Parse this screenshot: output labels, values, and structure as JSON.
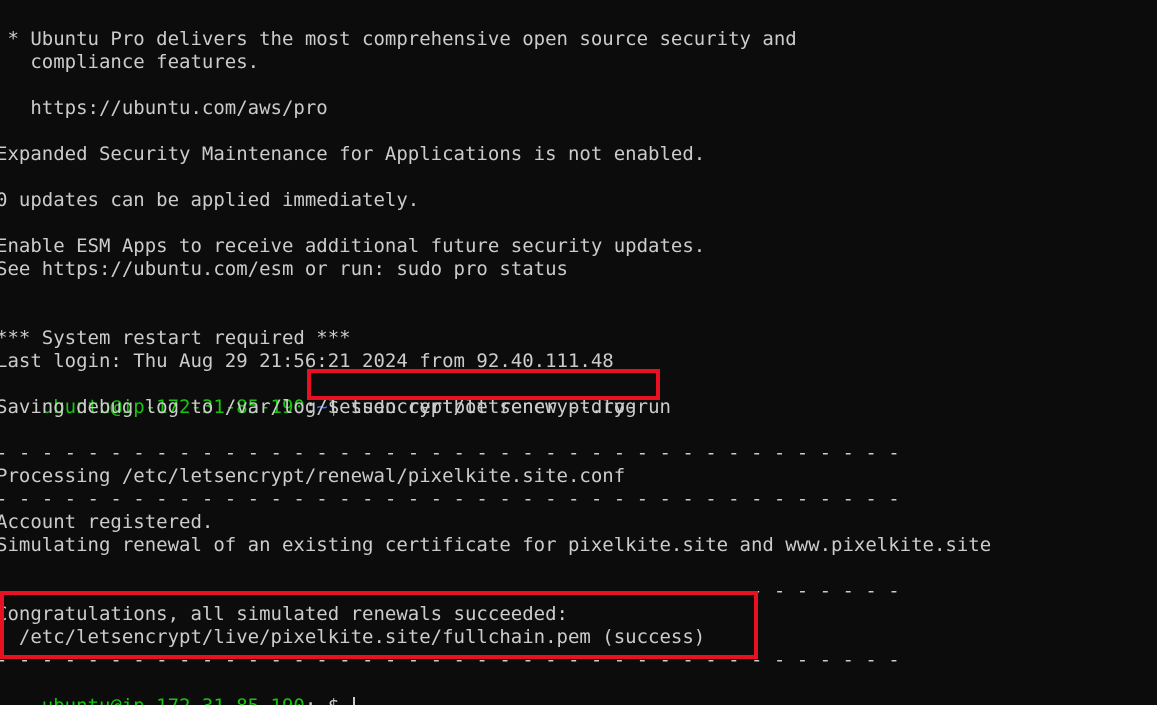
{
  "terminal": {
    "lines": [
      " * Ubuntu Pro delivers the most comprehensive open source security and",
      "   compliance features.",
      "",
      "   https://ubuntu.com/aws/pro",
      "",
      "Expanded Security Maintenance for Applications is not enabled.",
      "",
      "0 updates can be applied immediately.",
      "",
      "Enable ESM Apps to receive additional future security updates.",
      "See https://ubuntu.com/esm or run: sudo pro status",
      "",
      "",
      "*** System restart required ***",
      "Last login: Thu Aug 29 21:56:21 2024 from 92.40.111.48"
    ],
    "prompt1": {
      "user_host": "ubuntu@ip-172-31-85-190",
      "colon": ":",
      "path": "~",
      "dollar": "$ ",
      "command": "sudo certbot renew --dry-run"
    },
    "output": [
      "Saving debug log to /var/log/letsencrypt/letsencrypt.log",
      "",
      "- - - - - - - - - - - - - - - - - - - - - - - - - - - - - - - - - - - - - - - -",
      "Processing /etc/letsencrypt/renewal/pixelkite.site.conf",
      "- - - - - - - - - - - - - - - - - - - - - - - - - - - - - - - - - - - - - - - -",
      "Account registered.",
      "Simulating renewal of an existing certificate for pixelkite.site and www.pixelkite.site",
      "",
      "- - - - - - - - - - - - - - - - - - - - - - - - - - - - - - - - - - - - - - - -",
      "Congratulations, all simulated renewals succeeded:",
      "  /etc/letsencrypt/live/pixelkite.site/fullchain.pem (success)",
      "- - - - - - - - - - - - - - - - - - - - - - - - - - - - - - - - - - - - - - - -"
    ],
    "prompt2": {
      "user_host": "ubuntu@ip-172-31-85-190",
      "colon": ":",
      "path": "~",
      "dollar": "$ "
    },
    "colors": {
      "background": "#0c0c0c",
      "text": "#cccccc",
      "prompt_user": "#16c60c",
      "prompt_path": "#3b78ff",
      "highlight_border": "#e81123"
    }
  }
}
